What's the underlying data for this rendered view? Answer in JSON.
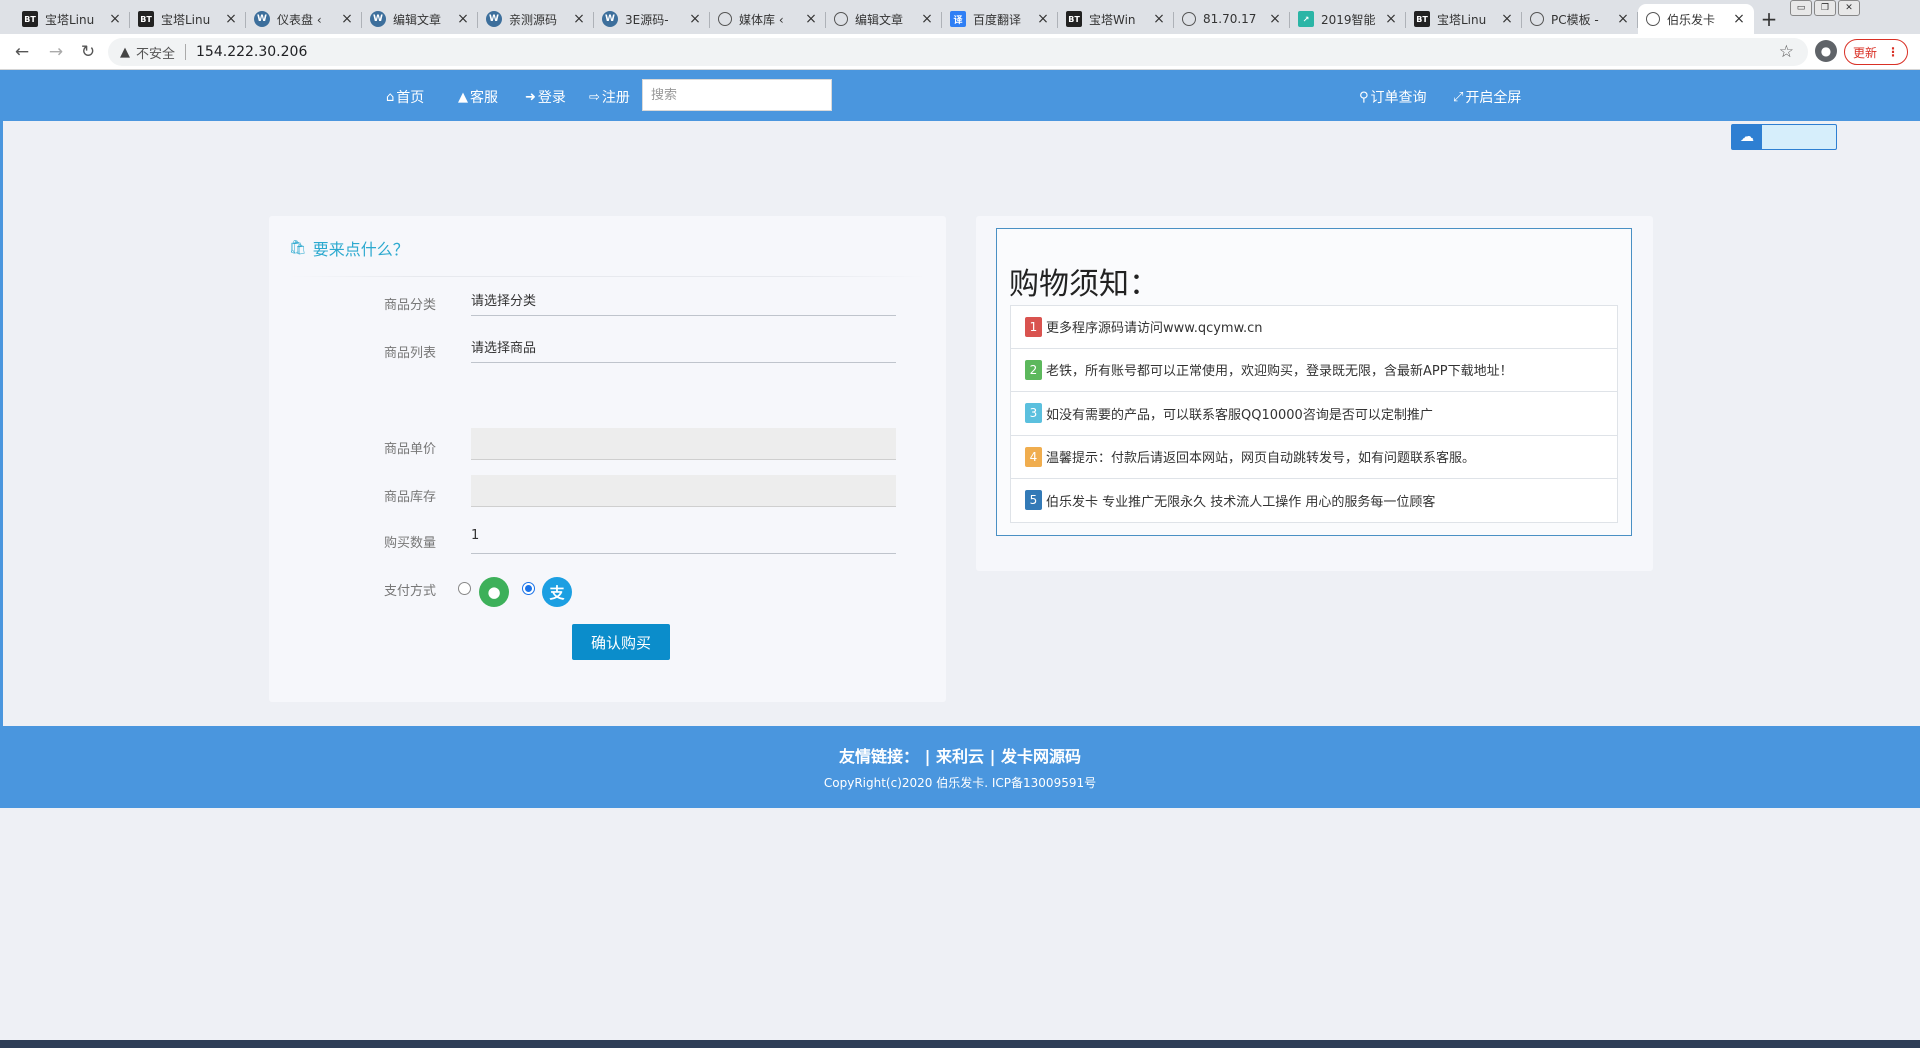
{
  "browser": {
    "tabs": [
      {
        "title": "宝塔Linu",
        "favicon": "BT"
      },
      {
        "title": "宝塔Linu",
        "favicon": "BT"
      },
      {
        "title": "仪表盘 ‹",
        "favicon": "wordpress-icon"
      },
      {
        "title": "编辑文章",
        "favicon": "wordpress-icon"
      },
      {
        "title": "亲测源码",
        "favicon": "wordpress-icon"
      },
      {
        "title": "3E源码-",
        "favicon": "wordpress-icon"
      },
      {
        "title": "媒体库 ‹",
        "favicon": "globe-icon"
      },
      {
        "title": "编辑文章",
        "favicon": "globe-icon"
      },
      {
        "title": "百度翻译",
        "favicon": "译"
      },
      {
        "title": "宝塔Win",
        "favicon": "BT"
      },
      {
        "title": "81.70.17",
        "favicon": "globe-icon"
      },
      {
        "title": "2019智能",
        "favicon": "chart-icon"
      },
      {
        "title": "宝塔Linu",
        "favicon": "BT"
      },
      {
        "title": "PC模板 -",
        "favicon": "globe-icon"
      },
      {
        "title": "伯乐发卡",
        "favicon": "globe-icon"
      }
    ],
    "insecure_label": "不安全",
    "url": "154.222.30.206",
    "update_label": "更新"
  },
  "nav": {
    "home": "首页",
    "service": "客服",
    "login": "登录",
    "register": "注册",
    "search_placeholder": "搜索",
    "order_query": "订单查询",
    "fullscreen": "开启全屏"
  },
  "order": {
    "heading": "要来点什么？",
    "category_label": "商品分类",
    "category_value": "请选择分类",
    "product_label": "商品列表",
    "product_value": "请选择商品",
    "price_label": "商品单价",
    "stock_label": "商品库存",
    "qty_label": "购买数量",
    "qty_value": "1",
    "pay_label": "支付方式",
    "pay_selected": "alipay",
    "wechat_glyph": "●",
    "alipay_glyph": "支",
    "confirm_label": "确认购买"
  },
  "notice": {
    "title": "购物须知：",
    "items": [
      {
        "num": "1",
        "text": "更多程序源码请访问www.qcymw.cn"
      },
      {
        "num": "2",
        "text": "老铁，所有账号都可以正常使用，欢迎购买，登录既无限，含最新APP下载地址！"
      },
      {
        "num": "3",
        "text": "如没有需要的产品，可以联系客服QQ10000咨询是否可以定制推广"
      },
      {
        "num": "4",
        "text": "温馨提示：付款后请返回本网站，网页自动跳转发号，如有问题联系客服。"
      },
      {
        "num": "5",
        "text": "伯乐发卡 专业推广无限永久 技术流人工操作 用心的服务每一位顾客"
      }
    ]
  },
  "footer": {
    "links_label": "友情链接：",
    "link1": "来利云",
    "link2": "发卡网源码",
    "sep": "|",
    "copyright": "CopyRight(c)2020 伯乐发卡. ICP备13009591号"
  },
  "colors": {
    "nav_bg": "#4a96de",
    "accent": "#0b8dcb",
    "heading": "#2ca9cf"
  }
}
